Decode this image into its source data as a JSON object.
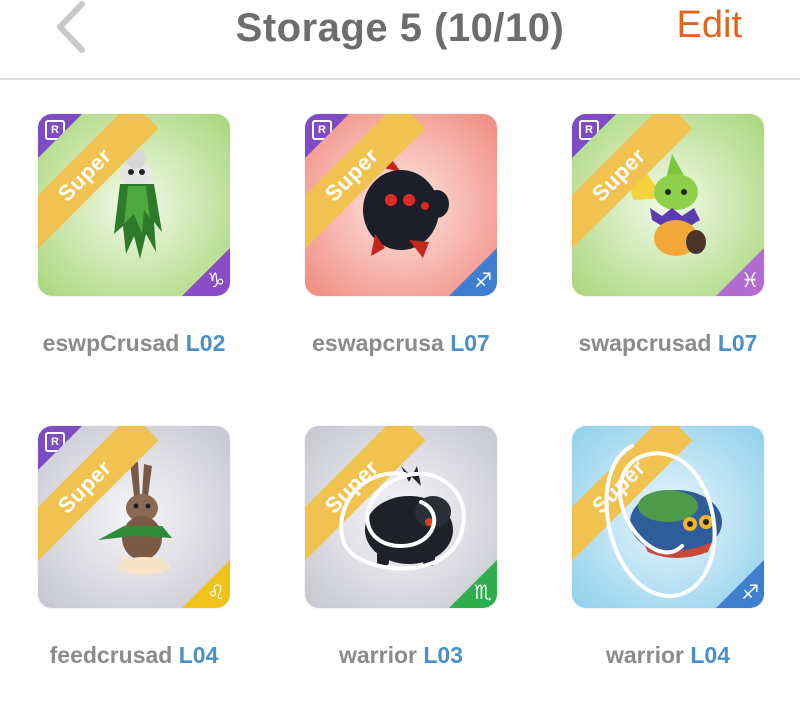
{
  "header": {
    "back_icon": "chevron-left-icon",
    "title": "Storage 5 (10/10)",
    "edit_label": "Edit"
  },
  "colors": {
    "accent": "#e2651e",
    "title": "#6d6d6d",
    "level": "#4b8fc9",
    "ribbon": "#f2c250",
    "rarity_badge": "#7d4bc4"
  },
  "cards": [
    {
      "name": "eswpCrusad",
      "level": "L02",
      "tag": "Super",
      "rarity": "R",
      "sign_icon": "capricorn-icon",
      "sign_glyph": "♑",
      "background": "green"
    },
    {
      "name": "eswapcrusa",
      "level": "L07",
      "tag": "Super",
      "rarity": "R",
      "sign_icon": "sagittarius-icon",
      "sign_glyph": "♐",
      "background": "red"
    },
    {
      "name": "swapcrusad",
      "level": "L07",
      "tag": "Super",
      "rarity": "R",
      "sign_icon": "pisces-icon",
      "sign_glyph": "♓",
      "background": "green"
    },
    {
      "name": "feedcrusad",
      "level": "L04",
      "tag": "Super",
      "rarity": "R",
      "sign_icon": "leo-icon",
      "sign_glyph": "♌",
      "background": "gray"
    },
    {
      "name": "warrior",
      "level": "L03",
      "tag": "Super",
      "rarity": "",
      "sign_icon": "scorpio-icon",
      "sign_glyph": "♏",
      "background": "gray"
    },
    {
      "name": "warrior",
      "level": "L04",
      "tag": "Super",
      "rarity": "",
      "sign_icon": "sagittarius-icon",
      "sign_glyph": "♐",
      "background": "blue"
    }
  ]
}
